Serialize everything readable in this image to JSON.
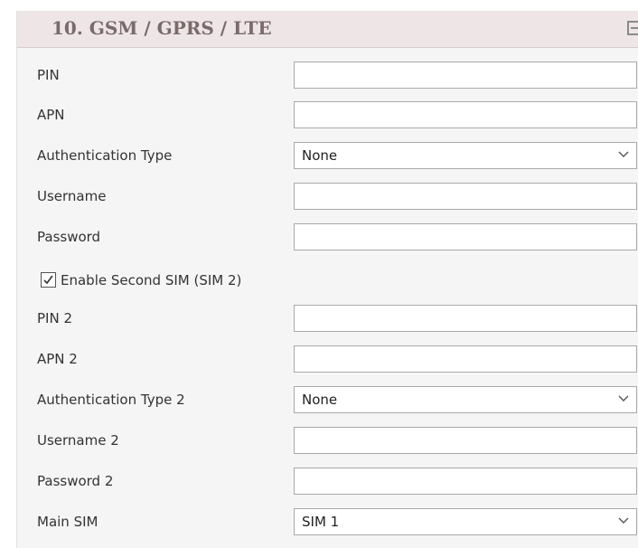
{
  "section": {
    "title": "10. GSM / GPRS / LTE",
    "collapse_icon": "collapse-minus-icon"
  },
  "sim1": {
    "pin": {
      "label": "PIN",
      "value": ""
    },
    "apn": {
      "label": "APN",
      "value": ""
    },
    "auth_type": {
      "label": "Authentication Type",
      "value": "None"
    },
    "username": {
      "label": "Username",
      "value": ""
    },
    "password": {
      "label": "Password",
      "value": ""
    }
  },
  "second_sim": {
    "label": "Enable Second SIM (SIM 2)",
    "checked": true
  },
  "sim2": {
    "pin": {
      "label": "PIN 2",
      "value": ""
    },
    "apn": {
      "label": "APN 2",
      "value": ""
    },
    "auth_type": {
      "label": "Authentication Type 2",
      "value": "None"
    },
    "username": {
      "label": "Username 2",
      "value": ""
    },
    "password": {
      "label": "Password 2",
      "value": ""
    }
  },
  "main_sim": {
    "label": "Main SIM",
    "value": "SIM 1"
  },
  "colors": {
    "header_bg": "#ede5e6",
    "header_text": "#7a6a6c",
    "panel_bg": "#f5f5f5",
    "field_border": "#a9a9a9"
  }
}
